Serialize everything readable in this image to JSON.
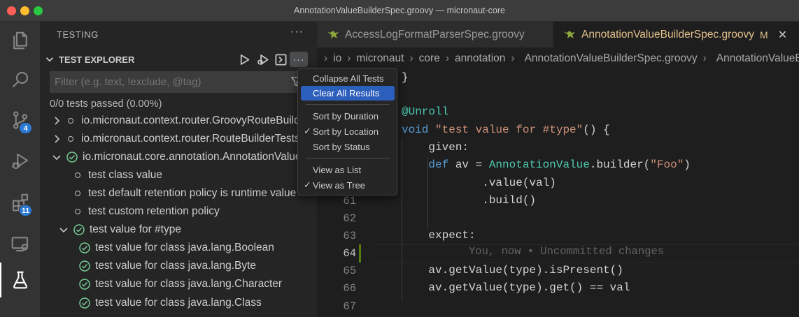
{
  "window": {
    "title": "AnnotationValueBuilderSpec.groovy — micronaut-core"
  },
  "activity_bar": {
    "items": [
      {
        "name": "explorer-icon"
      },
      {
        "name": "search-icon"
      },
      {
        "name": "source-control-icon",
        "badge": "4"
      },
      {
        "name": "run-debug-icon"
      },
      {
        "name": "extensions-icon",
        "badge": "11"
      },
      {
        "name": "remote-explorer-icon"
      },
      {
        "name": "testing-icon",
        "active": true
      }
    ]
  },
  "sidebar": {
    "header": "TESTING",
    "more": "···",
    "section": "TEST EXPLORER",
    "filter_placeholder": "Filter (e.g. text, !exclude, @tag)",
    "status": "0/0 tests passed (0.00%)",
    "tree": [
      {
        "label": "io.micronaut.context.router.GroovyRouteBuilderSpec",
        "state": "collapsed",
        "icon": "dot"
      },
      {
        "label": "io.micronaut.context.router.RouteBuilderTests",
        "state": "collapsed",
        "icon": "dot"
      },
      {
        "label": "io.micronaut.core.annotation.AnnotationValueBuilderSpec",
        "state": "expanded",
        "icon": "pass"
      },
      {
        "label": "test class value",
        "icon": "dot"
      },
      {
        "label": "test default retention policy is runtime value",
        "icon": "dot"
      },
      {
        "label": "test custom retention policy",
        "icon": "dot"
      },
      {
        "label": "test value for #type",
        "state": "expanded",
        "icon": "pass"
      },
      {
        "label": "test value for class java.lang.Boolean",
        "icon": "pass"
      },
      {
        "label": "test value for class java.lang.Byte",
        "icon": "pass"
      },
      {
        "label": "test value for class java.lang.Character",
        "icon": "pass"
      },
      {
        "label": "test value for class java.lang.Class",
        "icon": "pass"
      }
    ]
  },
  "context_menu": {
    "items": [
      {
        "label": "Collapse All Tests"
      },
      {
        "label": "Clear All Results",
        "highlighted": true
      },
      {
        "label": "Sort by Duration"
      },
      {
        "label": "Sort by Location",
        "checked": true
      },
      {
        "label": "Sort by Status"
      },
      {
        "label": "View as List"
      },
      {
        "label": "View as Tree",
        "checked": true
      }
    ],
    "check_glyph": "✓"
  },
  "tabs": [
    {
      "label": "AccessLogFormatParserSpec.groovy",
      "active": false
    },
    {
      "label": "AnnotationValueBuilderSpec.groovy",
      "active": true,
      "modified": "M",
      "close": "✕"
    }
  ],
  "breadcrumb": [
    "io",
    "micronaut",
    "core",
    "annotation",
    "AnnotationValueBuilderSpec.groovy",
    "AnnotationValueBuilderSpec"
  ],
  "editor": {
    "line_numbers": [
      "61",
      "62",
      "63",
      "64",
      "65",
      "66",
      "67"
    ],
    "blame": "You, now • Uncommitted changes"
  }
}
